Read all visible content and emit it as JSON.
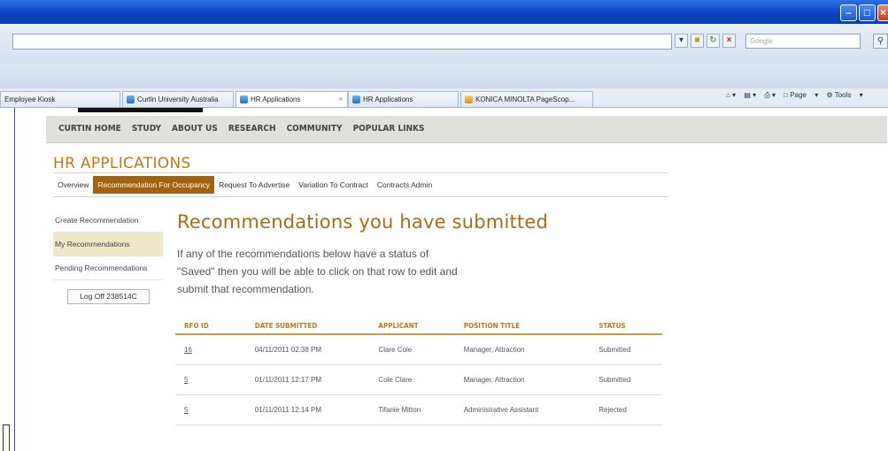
{
  "browser": {
    "search_placeholder": "Google",
    "tabs": [
      {
        "label": "Employee Kiosk"
      },
      {
        "label": "Curtin University Australia"
      },
      {
        "label": "HR Applications"
      },
      {
        "label": "HR Applications"
      },
      {
        "label": "KONICA MINOLTA PageScop..."
      }
    ],
    "commands": {
      "page": "Page",
      "tools": "Tools"
    }
  },
  "site_nav": [
    "CURTIN HOME",
    "STUDY",
    "ABOUT US",
    "RESEARCH",
    "COMMUNITY",
    "POPULAR LINKS"
  ],
  "app_title": "HR APPLICATIONS",
  "subnav": [
    {
      "label": "Overview",
      "active": false
    },
    {
      "label": "Recommendation For Occupancy",
      "active": true
    },
    {
      "label": "Request To Advertise",
      "active": false
    },
    {
      "label": "Variation To Contract",
      "active": false
    },
    {
      "label": "Contracts Admin",
      "active": false
    }
  ],
  "leftnav": [
    {
      "label": "Create Recommendation",
      "active": false
    },
    {
      "label": "My Recommendations",
      "active": true
    },
    {
      "label": "Pending Recommendations",
      "active": false
    }
  ],
  "logoff_label": "Log Off 238514C",
  "heading": "Recommendations you have submitted",
  "intro": "If any of the recommendations below have a status of \"Saved\" then you will be able to click on that row to edit and submit that recommendation.",
  "table": {
    "headers": [
      "RFO ID",
      "DATE SUBMITTED",
      "APPLICANT",
      "POSITION TITLE",
      "STATUS"
    ],
    "rows": [
      [
        "16",
        "04/11/2011 02:38 PM",
        "Clare Cole",
        "Manager, Attraction",
        "Submitted"
      ],
      [
        "5",
        "01/11/2011 12:17 PM",
        "Cole Clare",
        "Manager, Attraction",
        "Submitted"
      ],
      [
        "5",
        "01/11/2011 12:14 PM",
        "Tifanie Mitton",
        "Administrative Assistant",
        "Rejected"
      ]
    ]
  },
  "colors": {
    "accent": "#a86d10",
    "active_tab": "#a3630e",
    "active_side": "#efe8c9"
  }
}
